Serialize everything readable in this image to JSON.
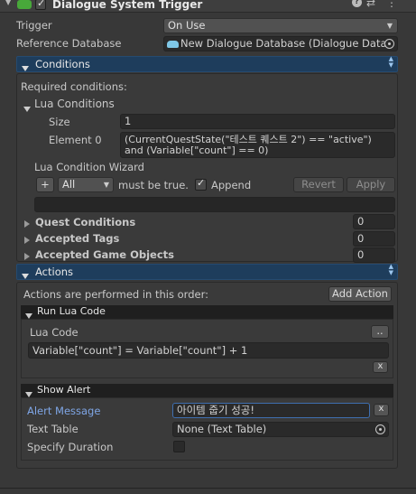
{
  "component": {
    "title": "Dialogue System Trigger",
    "enabled": true
  },
  "trigger": {
    "label": "Trigger",
    "value": "On Use"
  },
  "reference_database": {
    "label": "Reference Database",
    "value": "New Dialogue Database (Dialogue Data"
  },
  "conditions": {
    "header": "Conditions",
    "required_label": "Required conditions:",
    "lua_conditions": {
      "label": "Lua Conditions",
      "size_label": "Size",
      "size_value": "1",
      "element0_label": "Element 0",
      "element0_line1": "(CurrentQuestState(\"테스트 퀘스트 2\") == \"active\")",
      "element0_line2": "and (Variable[\"count\"] == 0)"
    },
    "wizard": {
      "label": "Lua Condition Wizard",
      "add_label": "+",
      "mode_value": "All",
      "must_be_true": "must be true.",
      "append_label": "Append",
      "append_checked": true,
      "revert_label": "Revert",
      "apply_label": "Apply"
    },
    "quest_conditions": {
      "label": "Quest Conditions",
      "value": "0"
    },
    "accepted_tags": {
      "label": "Accepted Tags",
      "value": "0"
    },
    "accepted_game_objects": {
      "label": "Accepted Game Objects",
      "value": "0"
    }
  },
  "actions": {
    "header": "Actions",
    "order_text": "Actions are performed in this order:",
    "add_action_label": "Add Action",
    "run_lua": {
      "header": "Run Lua Code",
      "lua_code_label": "Lua Code",
      "ellipsis_label": "..",
      "code": "Variable[\"count\"] = Variable[\"count\"] + 1",
      "remove_label": "x"
    },
    "show_alert": {
      "header": "Show Alert",
      "alert_message_label": "Alert Message",
      "alert_message_value": "아이템 줍기 성공!",
      "remove_label": "x",
      "text_table_label": "Text Table",
      "text_table_value": "None (Text Table)",
      "specify_duration_label": "Specify Duration",
      "specify_duration_checked": false
    }
  },
  "colors": {
    "section_header": "#1e3d5c",
    "background": "#383838",
    "field": "#2a2a2a",
    "alert_label": "#7fa6e6"
  },
  "icons": [
    "foldout-down-icon",
    "component-script-icon",
    "help-icon",
    "preset-icon",
    "kebab-menu-icon",
    "object-picker-icon",
    "reorder-icon",
    "dropdown-arrow-icon"
  ]
}
